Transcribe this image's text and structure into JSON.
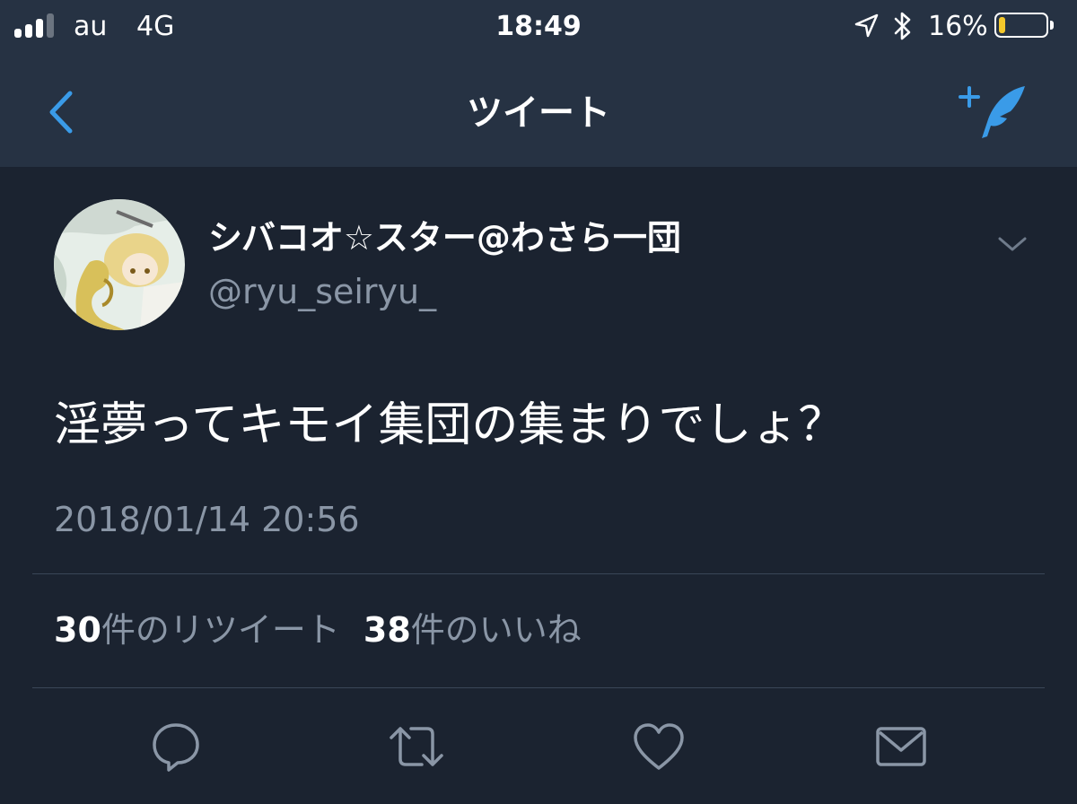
{
  "status_bar": {
    "carrier": "au",
    "network": "4G",
    "time": "18:49",
    "battery_percent": "16%",
    "battery_level": 0.16,
    "signal_bars_active": 3,
    "signal_bars_total": 4
  },
  "nav": {
    "title": "ツイート",
    "back_icon": "chevron-left-icon",
    "compose_icon": "compose-quill-icon"
  },
  "tweet": {
    "display_name": "シバコオ☆スター@わさら一団",
    "handle": "@ryu_seiryu_",
    "text": "淫夢ってキモイ集団の集まりでしょ？",
    "timestamp": "2018/01/14 20:56",
    "retweet_count": "30",
    "retweet_label": "件のリツイート",
    "like_count": "38",
    "like_label": "件のいいね"
  },
  "actions": [
    {
      "icon": "reply-icon"
    },
    {
      "icon": "retweet-icon"
    },
    {
      "icon": "heart-icon"
    },
    {
      "icon": "envelope-icon"
    }
  ],
  "colors": {
    "background": "#1b2330",
    "bar": "#263243",
    "accent": "#3a9be8",
    "muted_text": "#8a96a6",
    "icon": "#8a96a6",
    "battery": "#f4c82b"
  }
}
